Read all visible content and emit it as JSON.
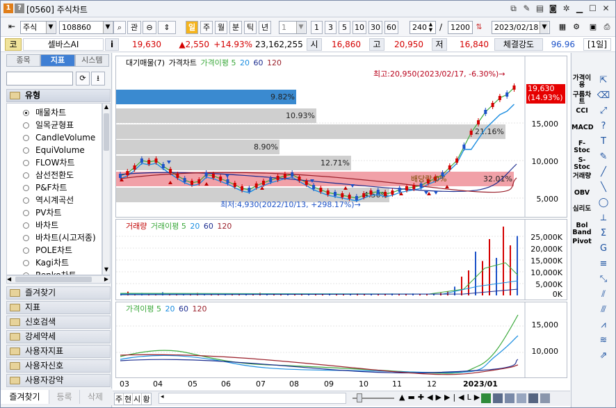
{
  "window": {
    "badge1": "1",
    "badge2": "?",
    "title": "[0560] 주식차트"
  },
  "toolbar": {
    "market": "주식",
    "code": "108860",
    "btn_gwan": "관",
    "periods": [
      "일",
      "주",
      "월",
      "분",
      "틱",
      "년"
    ],
    "interval": "1",
    "minutes": [
      "1",
      "3",
      "5",
      "10",
      "30",
      "60"
    ],
    "count": "240",
    "total": "1200",
    "date": "2023/02/18"
  },
  "quote": {
    "tag": "코",
    "name": "셀바스AI",
    "info": "i",
    "price": "19,630",
    "change": "▲2,550",
    "rate": "+14.93%",
    "volume": "23,162,255",
    "open_label": "시",
    "open": "16,860",
    "high_label": "고",
    "high": "20,950",
    "low_label": "저",
    "low": "16,840",
    "strength_label": "체결강도",
    "strength": "96.96",
    "period_tag": "[1일]"
  },
  "left": {
    "tabs": [
      "종목",
      "지표",
      "시스템"
    ],
    "section_type": "유형",
    "items": [
      "매물차트",
      "일목균형표",
      "CandleVolume",
      "EquiVolume",
      "FLOW차트",
      "삼선전환도",
      "P&F차트",
      "역시계곡선",
      "PV차트",
      "바차트",
      "바차트(시고저종)",
      "POLE차트",
      "Kagi차트",
      "Renko차트"
    ],
    "selected": 0,
    "sections": [
      "즐겨찾기",
      "지표",
      "신호검색",
      "강세약세",
      "사용자지표",
      "사용자신호",
      "사용자강약"
    ],
    "bottom_tabs": [
      "즐겨찾기",
      "등록",
      "삭제"
    ]
  },
  "price_pane": {
    "legend": [
      "대기매물(7)",
      "가격차트",
      "가격이평 5",
      "20",
      "60",
      "120"
    ],
    "high_note": "최고:20,950(2023/02/17, -6.30%)→",
    "low_note": "최저:4,930(2022/10/13, +298.17%)→",
    "dividend_note": "배당락:0%",
    "current_price": "19,630",
    "current_rate": "(14.93%)",
    "bars": [
      "9.82%",
      "10.93%",
      "21.16%",
      "8.90%",
      "12.71%",
      "32.01%",
      "4.50%"
    ],
    "yticks": [
      "15,000",
      "10,000",
      "5,000"
    ]
  },
  "volume_pane": {
    "legend": [
      "거래량",
      "거래이평 5",
      "20",
      "60",
      "120"
    ],
    "yticks": [
      "25,000K",
      "20,000K",
      "15,000K",
      "10,000K",
      "5,000K",
      "0K"
    ]
  },
  "ma_pane": {
    "legend": [
      "가격이평 5",
      "20",
      "60",
      "120"
    ],
    "yticks": [
      "15,000",
      "10,000"
    ]
  },
  "xaxis": [
    "03",
    "04",
    "05",
    "06",
    "07",
    "08",
    "09",
    "10",
    "11",
    "12",
    "2023/01"
  ],
  "statusbar": {
    "tabs": [
      "주",
      "현",
      "시",
      "황"
    ]
  },
  "right_toolbar": {
    "labels": [
      "가격이용",
      "구름차트",
      "CCI",
      "MACD",
      "F-Stoc",
      "S-Stoc",
      "거래량",
      "OBV",
      "심리도",
      "Bol Band",
      "Pivot"
    ]
  },
  "colors": {
    "up": "#d40000",
    "down": "#1c52c8",
    "accent": "#3f7fd4",
    "volprofile_hl": "#f1a1a8",
    "volprofile": "#cfcfcf",
    "volprofile_top": "#3a8ad0"
  }
}
